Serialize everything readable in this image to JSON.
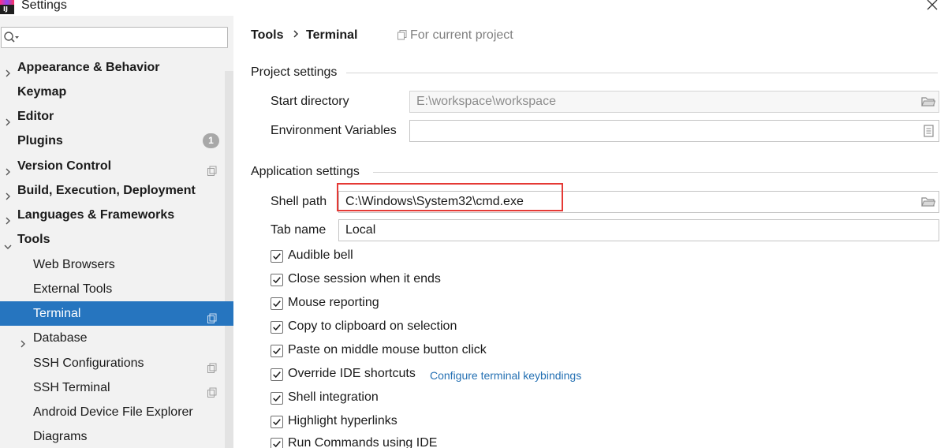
{
  "window": {
    "title": "Settings"
  },
  "search": {
    "placeholder": "",
    "value": ""
  },
  "sidebar": {
    "items": [
      {
        "label": "Appearance & Behavior",
        "level": 0,
        "expandable": true
      },
      {
        "label": "Keymap",
        "level": 0,
        "expandable": false
      },
      {
        "label": "Editor",
        "level": 0,
        "expandable": true
      },
      {
        "label": "Plugins",
        "level": 0,
        "expandable": false,
        "badge": "1"
      },
      {
        "label": "Version Control",
        "level": 0,
        "expandable": true,
        "project_icon": "project-scope-icon"
      },
      {
        "label": "Build, Execution, Deployment",
        "level": 0,
        "expandable": true
      },
      {
        "label": "Languages & Frameworks",
        "level": 0,
        "expandable": true
      },
      {
        "label": "Tools",
        "level": 0,
        "expandable": true,
        "expanded": true
      },
      {
        "label": "Web Browsers",
        "level": 1
      },
      {
        "label": "External Tools",
        "level": 1
      },
      {
        "label": "Terminal",
        "level": 1,
        "selected": true,
        "project_icon": "project-scope-icon"
      },
      {
        "label": "Database",
        "level": 1,
        "expandable": true
      },
      {
        "label": "SSH Configurations",
        "level": 1,
        "project_icon": "project-scope-icon"
      },
      {
        "label": "SSH Terminal",
        "level": 1,
        "project_icon": "project-scope-icon"
      },
      {
        "label": "Android Device File Explorer",
        "level": 1
      },
      {
        "label": "Diagrams",
        "level": 1
      }
    ]
  },
  "breadcrumb": {
    "parent": "Tools",
    "current": "Terminal",
    "scope": "For current project"
  },
  "project_settings": {
    "title": "Project settings",
    "start_directory": {
      "label": "Start directory",
      "value": "E:\\workspace\\workspace"
    },
    "env_vars": {
      "label": "Environment Variables",
      "value": ""
    }
  },
  "application_settings": {
    "title": "Application settings",
    "shell_path": {
      "label": "Shell path",
      "value": "C:\\Windows\\System32\\cmd.exe"
    },
    "tab_name": {
      "label": "Tab name",
      "value": "Local"
    },
    "checkboxes": [
      {
        "label": "Audible bell",
        "checked": true
      },
      {
        "label": "Close session when it ends",
        "checked": true
      },
      {
        "label": "Mouse reporting",
        "checked": true
      },
      {
        "label": "Copy to clipboard on selection",
        "checked": true
      },
      {
        "label": "Paste on middle mouse button click",
        "checked": true
      },
      {
        "label": "Override IDE shortcuts",
        "checked": true
      },
      {
        "label": "Shell integration",
        "checked": true
      },
      {
        "label": "Highlight hyperlinks",
        "checked": true
      },
      {
        "label": "Run Commands using IDE",
        "checked": true
      }
    ],
    "keybindings_link": "Configure terminal keybindings"
  },
  "colors": {
    "selection": "#2675bf",
    "link": "#2470b3",
    "highlight_box": "#e53935"
  }
}
